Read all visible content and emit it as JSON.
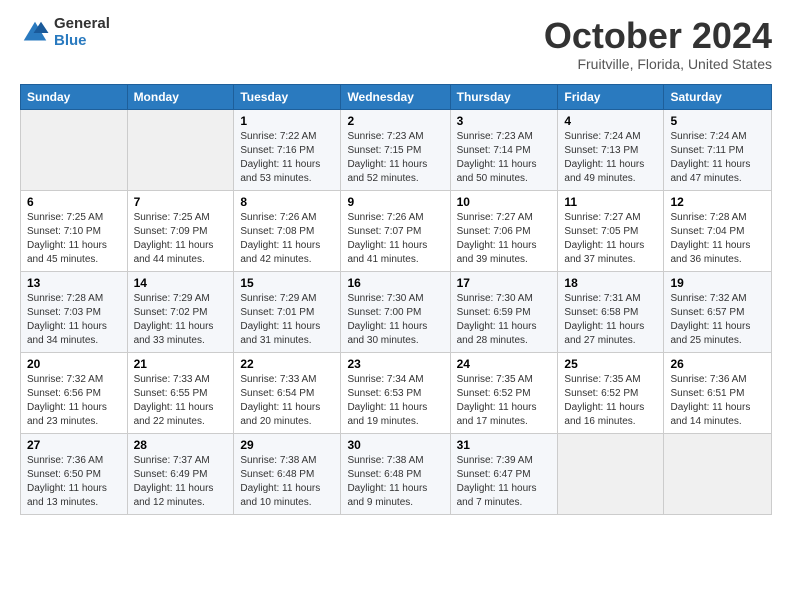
{
  "header": {
    "logo_general": "General",
    "logo_blue": "Blue",
    "month_title": "October 2024",
    "location": "Fruitville, Florida, United States"
  },
  "weekdays": [
    "Sunday",
    "Monday",
    "Tuesday",
    "Wednesday",
    "Thursday",
    "Friday",
    "Saturday"
  ],
  "weeks": [
    [
      {
        "day": "",
        "content": ""
      },
      {
        "day": "",
        "content": ""
      },
      {
        "day": "1",
        "content": "Sunrise: 7:22 AM\nSunset: 7:16 PM\nDaylight: 11 hours and 53 minutes."
      },
      {
        "day": "2",
        "content": "Sunrise: 7:23 AM\nSunset: 7:15 PM\nDaylight: 11 hours and 52 minutes."
      },
      {
        "day": "3",
        "content": "Sunrise: 7:23 AM\nSunset: 7:14 PM\nDaylight: 11 hours and 50 minutes."
      },
      {
        "day": "4",
        "content": "Sunrise: 7:24 AM\nSunset: 7:13 PM\nDaylight: 11 hours and 49 minutes."
      },
      {
        "day": "5",
        "content": "Sunrise: 7:24 AM\nSunset: 7:11 PM\nDaylight: 11 hours and 47 minutes."
      }
    ],
    [
      {
        "day": "6",
        "content": "Sunrise: 7:25 AM\nSunset: 7:10 PM\nDaylight: 11 hours and 45 minutes."
      },
      {
        "day": "7",
        "content": "Sunrise: 7:25 AM\nSunset: 7:09 PM\nDaylight: 11 hours and 44 minutes."
      },
      {
        "day": "8",
        "content": "Sunrise: 7:26 AM\nSunset: 7:08 PM\nDaylight: 11 hours and 42 minutes."
      },
      {
        "day": "9",
        "content": "Sunrise: 7:26 AM\nSunset: 7:07 PM\nDaylight: 11 hours and 41 minutes."
      },
      {
        "day": "10",
        "content": "Sunrise: 7:27 AM\nSunset: 7:06 PM\nDaylight: 11 hours and 39 minutes."
      },
      {
        "day": "11",
        "content": "Sunrise: 7:27 AM\nSunset: 7:05 PM\nDaylight: 11 hours and 37 minutes."
      },
      {
        "day": "12",
        "content": "Sunrise: 7:28 AM\nSunset: 7:04 PM\nDaylight: 11 hours and 36 minutes."
      }
    ],
    [
      {
        "day": "13",
        "content": "Sunrise: 7:28 AM\nSunset: 7:03 PM\nDaylight: 11 hours and 34 minutes."
      },
      {
        "day": "14",
        "content": "Sunrise: 7:29 AM\nSunset: 7:02 PM\nDaylight: 11 hours and 33 minutes."
      },
      {
        "day": "15",
        "content": "Sunrise: 7:29 AM\nSunset: 7:01 PM\nDaylight: 11 hours and 31 minutes."
      },
      {
        "day": "16",
        "content": "Sunrise: 7:30 AM\nSunset: 7:00 PM\nDaylight: 11 hours and 30 minutes."
      },
      {
        "day": "17",
        "content": "Sunrise: 7:30 AM\nSunset: 6:59 PM\nDaylight: 11 hours and 28 minutes."
      },
      {
        "day": "18",
        "content": "Sunrise: 7:31 AM\nSunset: 6:58 PM\nDaylight: 11 hours and 27 minutes."
      },
      {
        "day": "19",
        "content": "Sunrise: 7:32 AM\nSunset: 6:57 PM\nDaylight: 11 hours and 25 minutes."
      }
    ],
    [
      {
        "day": "20",
        "content": "Sunrise: 7:32 AM\nSunset: 6:56 PM\nDaylight: 11 hours and 23 minutes."
      },
      {
        "day": "21",
        "content": "Sunrise: 7:33 AM\nSunset: 6:55 PM\nDaylight: 11 hours and 22 minutes."
      },
      {
        "day": "22",
        "content": "Sunrise: 7:33 AM\nSunset: 6:54 PM\nDaylight: 11 hours and 20 minutes."
      },
      {
        "day": "23",
        "content": "Sunrise: 7:34 AM\nSunset: 6:53 PM\nDaylight: 11 hours and 19 minutes."
      },
      {
        "day": "24",
        "content": "Sunrise: 7:35 AM\nSunset: 6:52 PM\nDaylight: 11 hours and 17 minutes."
      },
      {
        "day": "25",
        "content": "Sunrise: 7:35 AM\nSunset: 6:52 PM\nDaylight: 11 hours and 16 minutes."
      },
      {
        "day": "26",
        "content": "Sunrise: 7:36 AM\nSunset: 6:51 PM\nDaylight: 11 hours and 14 minutes."
      }
    ],
    [
      {
        "day": "27",
        "content": "Sunrise: 7:36 AM\nSunset: 6:50 PM\nDaylight: 11 hours and 13 minutes."
      },
      {
        "day": "28",
        "content": "Sunrise: 7:37 AM\nSunset: 6:49 PM\nDaylight: 11 hours and 12 minutes."
      },
      {
        "day": "29",
        "content": "Sunrise: 7:38 AM\nSunset: 6:48 PM\nDaylight: 11 hours and 10 minutes."
      },
      {
        "day": "30",
        "content": "Sunrise: 7:38 AM\nSunset: 6:48 PM\nDaylight: 11 hours and 9 minutes."
      },
      {
        "day": "31",
        "content": "Sunrise: 7:39 AM\nSunset: 6:47 PM\nDaylight: 11 hours and 7 minutes."
      },
      {
        "day": "",
        "content": ""
      },
      {
        "day": "",
        "content": ""
      }
    ]
  ]
}
